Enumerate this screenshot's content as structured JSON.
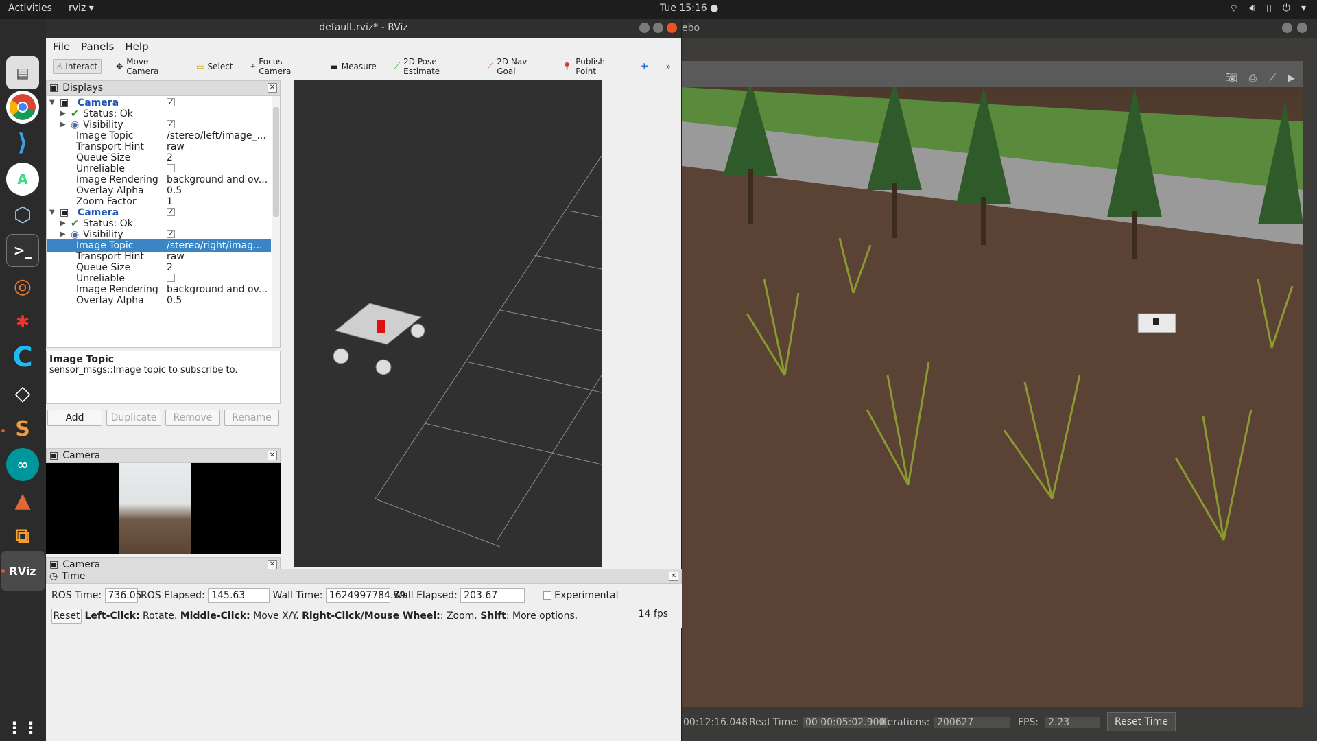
{
  "topbar": {
    "activities": "Activities",
    "app_menu": "rviz",
    "clock": "Tue 15:16"
  },
  "dock": {
    "items": [
      "files-icon",
      "chrome-icon",
      "vscode-icon",
      "android-studio-icon",
      "virtualbox-icon",
      "terminal-icon",
      "blender-icon",
      "coppeliasim-icon",
      "clion-icon",
      "unity-icon",
      "sublime-text-icon",
      "arduino-icon",
      "matlab-icon",
      "stack-icon",
      "rviz-icon",
      "show-apps-icon"
    ]
  },
  "rviz": {
    "title": "default.rviz* - RViz",
    "menu": {
      "file": "File",
      "panels": "Panels",
      "help": "Help"
    },
    "toolbar": {
      "interact": "Interact",
      "move_camera": "Move Camera",
      "select": "Select",
      "focus_camera": "Focus Camera",
      "measure": "Measure",
      "pose_estimate": "2D Pose Estimate",
      "nav_goal": "2D Nav Goal",
      "publish_point": "Publish Point",
      "more": "»"
    },
    "displays": {
      "header": "Displays",
      "rows": [
        {
          "key": "Camera",
          "value": ""
        },
        {
          "key": "Status: Ok",
          "value": ""
        },
        {
          "key": "Visibility",
          "value": ""
        },
        {
          "key": "Image Topic",
          "value": "/stereo/left/image_..."
        },
        {
          "key": "Transport Hint",
          "value": "raw"
        },
        {
          "key": "Queue Size",
          "value": "2"
        },
        {
          "key": "Unreliable",
          "value": ""
        },
        {
          "key": "Image Rendering",
          "value": "background and ov..."
        },
        {
          "key": "Overlay Alpha",
          "value": "0.5"
        },
        {
          "key": "Zoom Factor",
          "value": "1"
        },
        {
          "key": "Camera",
          "value": ""
        },
        {
          "key": "Status: Ok",
          "value": ""
        },
        {
          "key": "Visibility",
          "value": ""
        },
        {
          "key": "Image Topic",
          "value": "/stereo/right/imag..."
        },
        {
          "key": "Transport Hint",
          "value": "raw"
        },
        {
          "key": "Queue Size",
          "value": "2"
        },
        {
          "key": "Unreliable",
          "value": ""
        },
        {
          "key": "Image Rendering",
          "value": "background and ov..."
        },
        {
          "key": "Overlay Alpha",
          "value": "0.5"
        }
      ],
      "description_title": "Image Topic",
      "description_text": "sensor_msgs::Image topic to subscribe to.",
      "buttons": {
        "add": "Add",
        "duplicate": "Duplicate",
        "remove": "Remove",
        "rename": "Rename"
      }
    },
    "camera_panel_1": {
      "title": "Camera"
    },
    "camera_panel_2": {
      "title": "Camera"
    },
    "time": {
      "header": "Time",
      "ros_time_label": "ROS Time:",
      "ros_time": "736.05",
      "ros_elapsed_label": "ROS Elapsed:",
      "ros_elapsed": "145.63",
      "wall_time_label": "Wall Time:",
      "wall_time": "1624997784.39",
      "wall_elapsed_label": "Wall Elapsed:",
      "wall_elapsed": "203.67",
      "experimental": "Experimental",
      "reset": "Reset",
      "hint_1b": "Left-Click:",
      "hint_1": "Rotate.",
      "hint_2b": "Middle-Click:",
      "hint_2": "Move X/Y.",
      "hint_3b": "Right-Click/Mouse Wheel:",
      "hint_3": ": Zoom.",
      "hint_4b": "Shift",
      "hint_4": ": More options.",
      "fps": "14 fps"
    }
  },
  "gazebo": {
    "title_fragment": "ebo",
    "sim_time": "00:12:16.048",
    "real_time_label": "Real Time:",
    "real_time": "00 00:05:02.900",
    "iterations_label": "Iterations:",
    "iterations": "200627",
    "fps_label": "FPS:",
    "fps": "2.23",
    "reset_time": "Reset Time"
  }
}
